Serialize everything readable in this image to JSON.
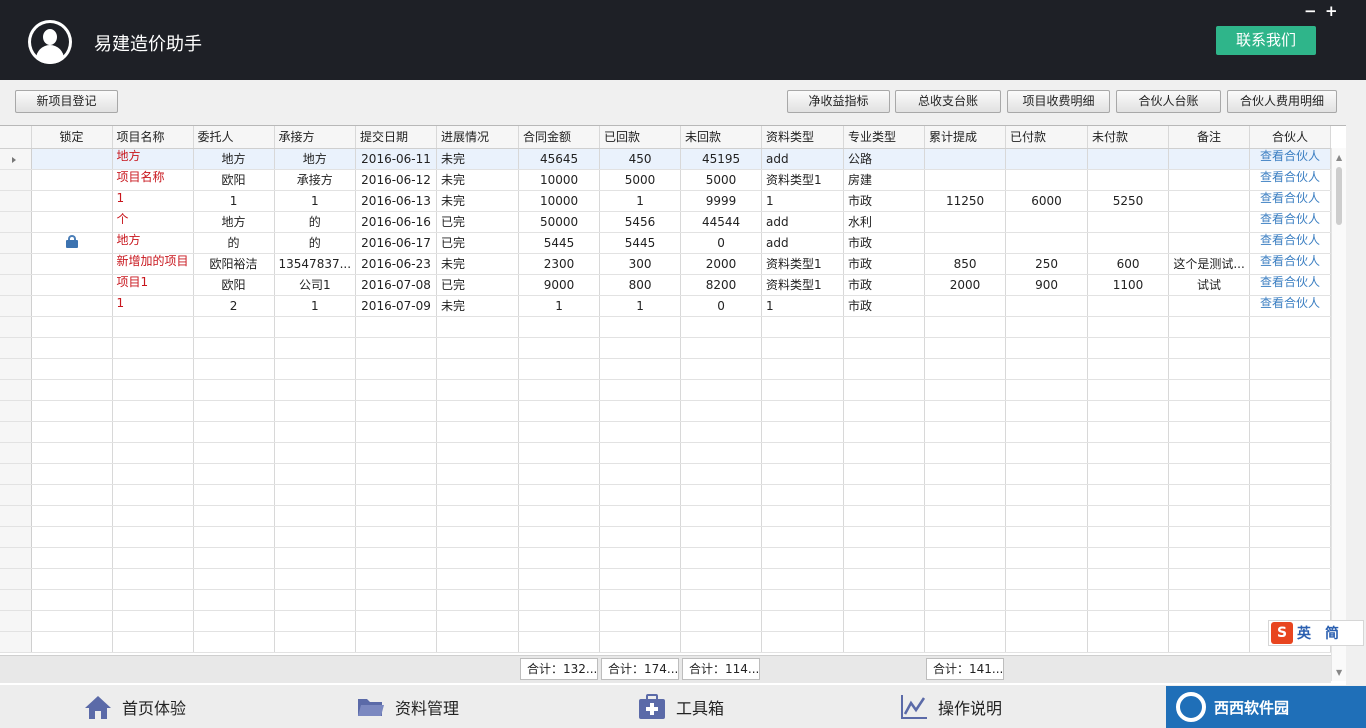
{
  "app": {
    "title": "易建造价助手",
    "contact_label": "联系我们",
    "minimize": "−",
    "maximize": "+"
  },
  "toolbar": {
    "new_project": "新项目登记",
    "net_income": "净收益指标",
    "total_ledger": "总收支台账",
    "project_fee_detail": "项目收费明细",
    "partner_ledger": "合伙人台账",
    "partner_fee_detail": "合伙人费用明细"
  },
  "grid": {
    "columns": [
      "锁定",
      "项目名称",
      "委托人",
      "承接方",
      "提交日期",
      "进展情况",
      "合同金额",
      "已回款",
      "未回款",
      "资料类型",
      "专业类型",
      "累计提成",
      "已付款",
      "未付款",
      "备注",
      "合伙人"
    ],
    "rows": [
      {
        "locked": false,
        "name": "地方",
        "client": "地方",
        "contractor": "地方",
        "date": "2016-06-11",
        "status": "未完",
        "amount": "45645",
        "received": "450",
        "unreceived": "45195",
        "doc_type": "add",
        "major": "公路",
        "commission": "",
        "paid": "",
        "unpaid": "",
        "note": "",
        "partner": "查看合伙人"
      },
      {
        "locked": false,
        "name": "项目名称",
        "client": "欧阳",
        "contractor": "承接方",
        "date": "2016-06-12",
        "status": "未完",
        "amount": "10000",
        "received": "5000",
        "unreceived": "5000",
        "doc_type": "资料类型1",
        "major": "房建",
        "commission": "",
        "paid": "",
        "unpaid": "",
        "note": "",
        "partner": "查看合伙人"
      },
      {
        "locked": false,
        "name": "1",
        "client": "1",
        "contractor": "1",
        "date": "2016-06-13",
        "status": "未完",
        "amount": "10000",
        "received": "1",
        "unreceived": "9999",
        "doc_type": "1",
        "major": "市政",
        "commission": "11250",
        "paid": "6000",
        "unpaid": "5250",
        "note": "",
        "partner": "查看合伙人"
      },
      {
        "locked": false,
        "name": "个",
        "client": "地方",
        "contractor": "的",
        "date": "2016-06-16",
        "status": "已完",
        "amount": "50000",
        "received": "5456",
        "unreceived": "44544",
        "doc_type": "add",
        "major": "水利",
        "commission": "",
        "paid": "",
        "unpaid": "",
        "note": "",
        "partner": "查看合伙人"
      },
      {
        "locked": true,
        "name": "地方",
        "client": "的",
        "contractor": "的",
        "date": "2016-06-17",
        "status": "已完",
        "amount": "5445",
        "received": "5445",
        "unreceived": "0",
        "doc_type": "add",
        "major": "市政",
        "commission": "",
        "paid": "",
        "unpaid": "",
        "note": "",
        "partner": "查看合伙人"
      },
      {
        "locked": false,
        "name": "新增加的项目",
        "client": "欧阳裕洁",
        "contractor": "13547837...",
        "date": "2016-06-23",
        "status": "未完",
        "amount": "2300",
        "received": "300",
        "unreceived": "2000",
        "doc_type": "资料类型1",
        "major": "市政",
        "commission": "850",
        "paid": "250",
        "unpaid": "600",
        "note": "这个是测试...",
        "partner": "查看合伙人"
      },
      {
        "locked": false,
        "name": "项目1",
        "client": "欧阳",
        "contractor": "公司1",
        "date": "2016-07-08",
        "status": "已完",
        "amount": "9000",
        "received": "800",
        "unreceived": "8200",
        "doc_type": "资料类型1",
        "major": "市政",
        "commission": "2000",
        "paid": "900",
        "unpaid": "1100",
        "note": "试试",
        "partner": "查看合伙人"
      },
      {
        "locked": false,
        "name": "1",
        "client": "2",
        "contractor": "1",
        "date": "2016-07-09",
        "status": "未完",
        "amount": "1",
        "received": "1",
        "unreceived": "0",
        "doc_type": "1",
        "major": "市政",
        "commission": "",
        "paid": "",
        "unpaid": "",
        "note": "",
        "partner": "查看合伙人"
      }
    ],
    "summary": {
      "amount": "合计：132...",
      "received": "合计：174...",
      "unreceived": "合计：114...",
      "commission": "合计：141..."
    }
  },
  "footer": {
    "home": "首页体验",
    "docs": "资料管理",
    "tools": "工具箱",
    "help": "操作说明"
  },
  "ime": {
    "logo": "S",
    "lang": "英",
    "mode": "简"
  },
  "watermark": {
    "text": "西西软件园"
  },
  "icons": [
    "user-avatar-icon",
    "lock-icon",
    "home-icon",
    "folder-icon",
    "toolbox-icon",
    "chart-icon",
    "row-pointer-icon"
  ]
}
